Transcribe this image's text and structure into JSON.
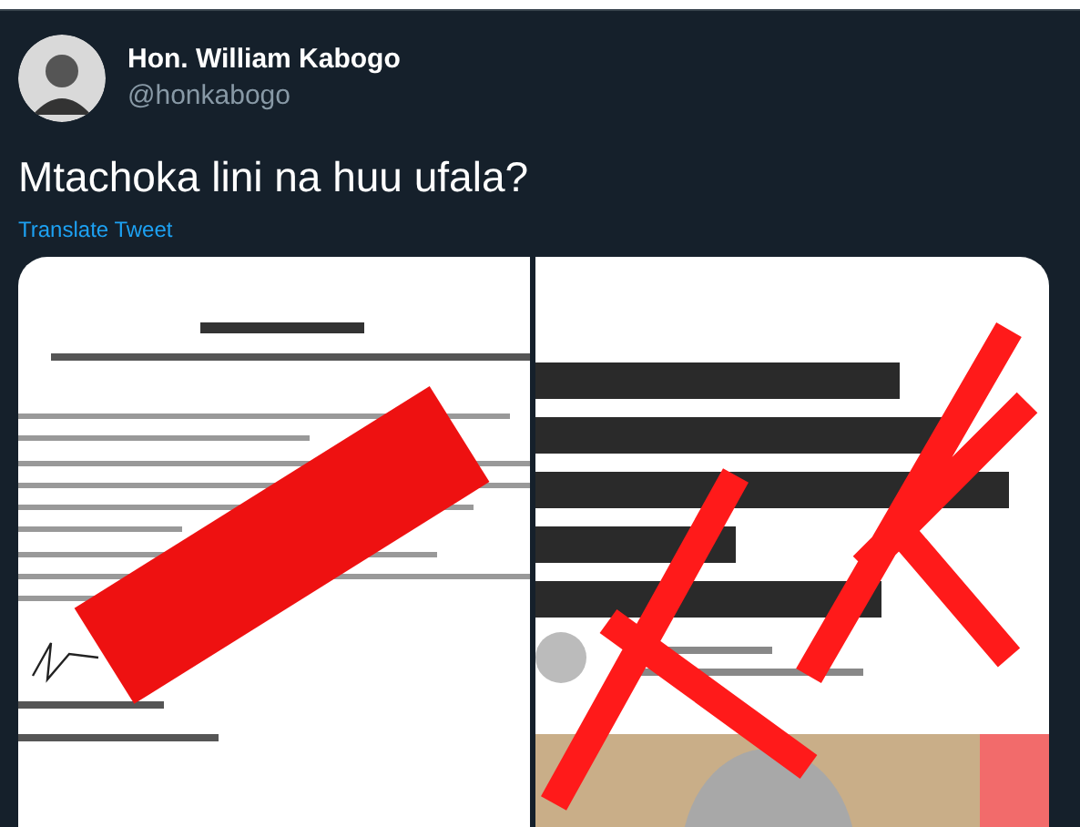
{
  "tweet": {
    "name": "Hon. William Kabogo",
    "handle": "@honkabogo",
    "text": "Mtachoka lini na huu ufala?",
    "translate": "Translate Tweet"
  }
}
